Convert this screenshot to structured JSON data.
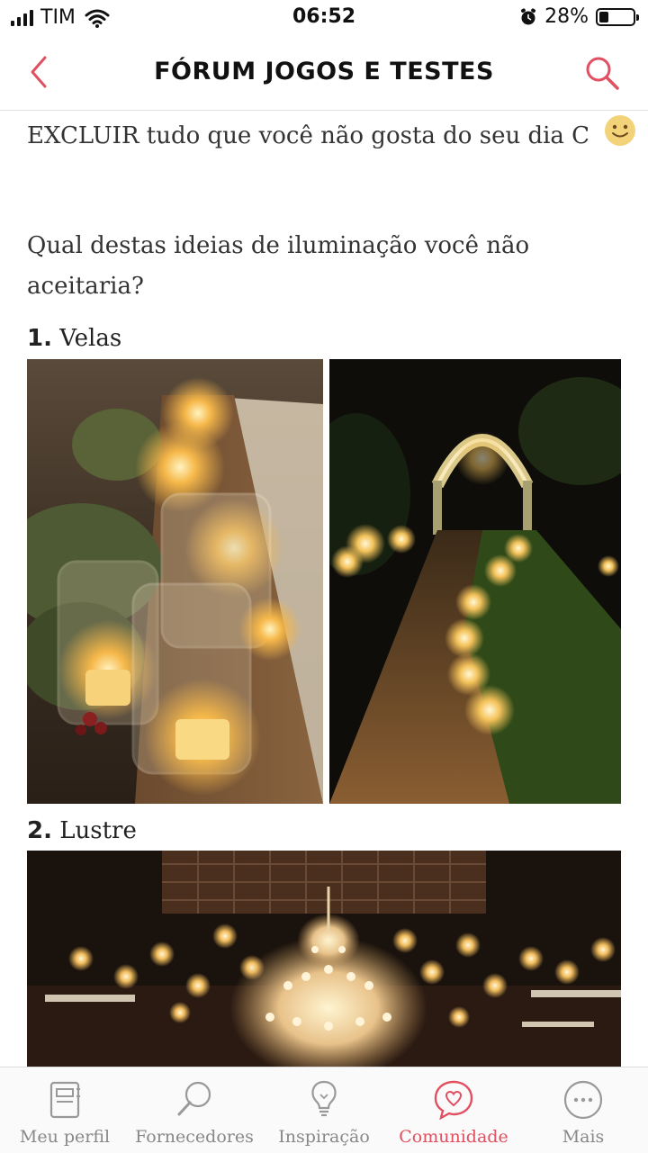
{
  "status_bar": {
    "carrier": "TIM",
    "time": "06:52",
    "battery_percent": "28%",
    "battery_level": 0.28,
    "icons": [
      "signal-icon",
      "wifi-icon",
      "alarm-icon",
      "battery-icon"
    ]
  },
  "header": {
    "title": "FÓRUM JOGOS E TESTES",
    "back_icon": "chevron-left-icon",
    "search_icon": "search-icon",
    "accent_color": "#e05060"
  },
  "post": {
    "intro": "EXCLUIR tudo que você não gosta do seu dia C",
    "question_line1": "Qual destas ideias de iluminação você não",
    "question_line2": "aceitaria?",
    "items": [
      {
        "number": "1.",
        "label": "Velas"
      },
      {
        "number": "2.",
        "label": "Lustre"
      }
    ]
  },
  "tabs": [
    {
      "label": "Meu perfil",
      "icon": "notebook-icon",
      "active": false
    },
    {
      "label": "Fornecedores",
      "icon": "magnifier-icon",
      "active": false
    },
    {
      "label": "Inspiração",
      "icon": "lightbulb-icon",
      "active": false
    },
    {
      "label": "Comunidade",
      "icon": "heart-chat-icon",
      "active": true
    },
    {
      "label": "Mais",
      "icon": "more-dots-icon",
      "active": false
    }
  ]
}
